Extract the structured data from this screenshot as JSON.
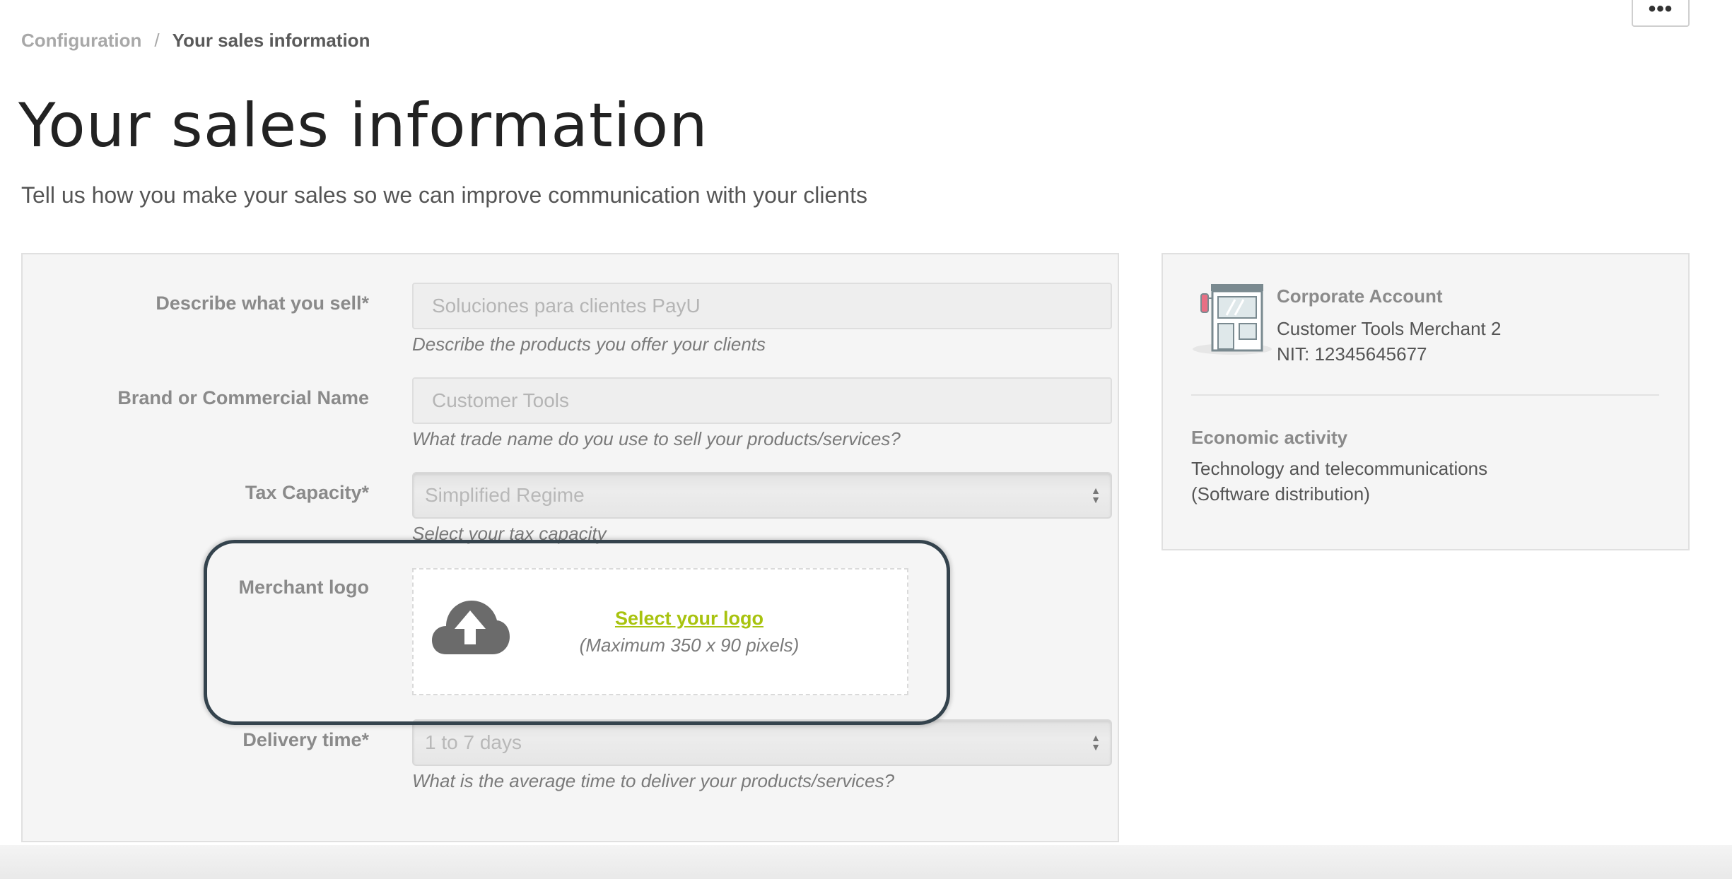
{
  "header": {
    "more_label": "•••",
    "breadcrumb": {
      "parent": "Configuration",
      "separator": "/",
      "current": "Your sales information"
    }
  },
  "page": {
    "title": "Your sales information",
    "subtitle": "Tell us how you make your sales so we can improve communication with your clients"
  },
  "form": {
    "describe": {
      "label": "Describe what you sell*",
      "value": "Soluciones para clientes PayU",
      "help": "Describe the products you offer your clients"
    },
    "brand": {
      "label": "Brand or Commercial Name",
      "value": "Customer Tools",
      "help": "What trade name do you use to sell your products/services?"
    },
    "tax": {
      "label": "Tax Capacity*",
      "value": "Simplified Regime",
      "help": "Select your tax capacity"
    },
    "logo": {
      "label": "Merchant logo",
      "link": "Select your logo",
      "hint": "(Maximum 350 x 90 pixels)",
      "icon": "cloud-upload-icon"
    },
    "delivery": {
      "label": "Delivery time*",
      "value": "1 to 7 days",
      "help": "What is the average time to deliver your products/services?"
    }
  },
  "account": {
    "icon": "store-icon",
    "title": "Corporate Account",
    "name": "Customer Tools Merchant 2",
    "nit": "NIT: 12345645677",
    "economic_title": "Economic activity",
    "economic_line1": "Technology and telecommunications",
    "economic_line2": "(Software distribution)"
  },
  "colors": {
    "link": "#a8c30f",
    "highlight_border": "#34434d",
    "card_bg": "#f5f5f5"
  }
}
